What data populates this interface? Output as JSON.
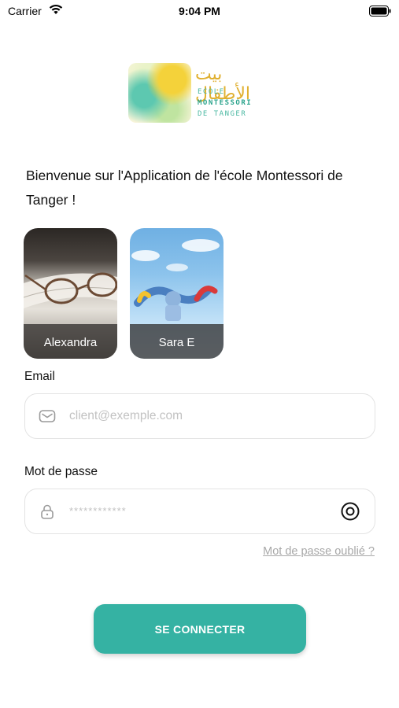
{
  "status_bar": {
    "carrier": "Carrier",
    "time": "9:04 PM"
  },
  "logo": {
    "arabic": "بيت الأطفال",
    "line1": "ECOLE",
    "line2": "MONTESSORI",
    "line3": "DE TANGER"
  },
  "welcome_text": "Bienvenue sur l'Application de l'école Montessori de Tanger !",
  "profiles": [
    {
      "name": "Alexandra"
    },
    {
      "name": "Sara E"
    }
  ],
  "form": {
    "email_label": "Email",
    "email_placeholder": "client@exemple.com",
    "password_label": "Mot de passe",
    "password_placeholder": "************",
    "forgot_password": "Mot de passe oublié ?",
    "submit_label": "SE CONNECTER"
  },
  "colors": {
    "accent": "#35b2a3",
    "link": "#a8a8a8"
  }
}
